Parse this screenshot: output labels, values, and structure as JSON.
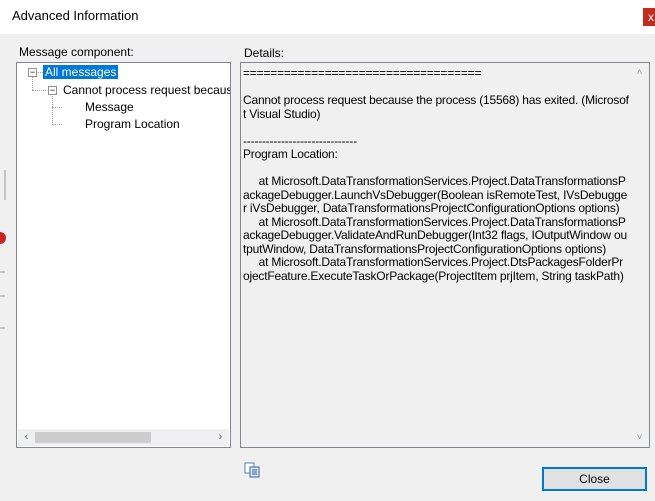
{
  "window": {
    "title": "Advanced Information",
    "close_glyph": "x"
  },
  "labels": {
    "message_component": "Message component:",
    "details": "Details:"
  },
  "tree": {
    "items": [
      {
        "label": "All messages",
        "expander": "−",
        "selected": true
      },
      {
        "label": "Cannot process request because",
        "expander": "−",
        "selected": false
      },
      {
        "label": "Message",
        "selected": false
      },
      {
        "label": "Program Location",
        "selected": false
      }
    ]
  },
  "details": {
    "text": "===================================\n\nCannot process request because the process (15568) has exited. (Microsoft Visual Studio)\n\n------------------------------\nProgram Location:\n\n     at Microsoft.DataTransformationServices.Project.DataTransformationsPackageDebugger.LaunchVsDebugger(Boolean isRemoteTest, IVsDebugger iVsDebugger, DataTransformationsProjectConfigurationOptions options)\n     at Microsoft.DataTransformationServices.Project.DataTransformationsPackageDebugger.ValidateAndRunDebugger(Int32 flags, IOutputWindow outputWindow, DataTransformationsProjectConfigurationOptions options)\n     at Microsoft.DataTransformationServices.Project.DtsPackagesFolderProjectFeature.ExecuteTaskOrPackage(ProjectItem prjItem, String taskPath)"
  },
  "buttons": {
    "close": "Close"
  },
  "icons": {
    "copy": "copy-icon",
    "scroll_left": "‹",
    "scroll_right": "›",
    "scroll_up": "˄",
    "scroll_down": "˅"
  },
  "colors": {
    "selection": "#0078d7",
    "close_x": "#c42b1c"
  }
}
